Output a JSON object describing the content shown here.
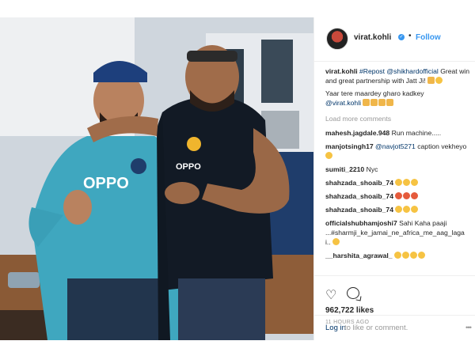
{
  "post": {
    "username": "virat.kohli",
    "follow_label": "Follow",
    "dot": "•",
    "more_icon": "ellipsis-icon"
  },
  "caption": {
    "user": "virat.kohli",
    "repost": "#Repost",
    "mention": "@shikhardofficial",
    "text": "Great win and great partnership with Jatt Ji!",
    "line2": "Yaar tere maardey gharo kadkey",
    "line3_mention": "@virat.kohli"
  },
  "load_more": "Load more comments",
  "comments": [
    {
      "user": "mahesh.jagdale.948",
      "text": "Run machine....."
    },
    {
      "user": "manjotsingh17",
      "mention": "@navjot5271",
      "text": "caption vekheyo"
    },
    {
      "user": "sumiti_2210",
      "text": "Nyc"
    },
    {
      "user": "shahzada_shoaib_74",
      "text": ""
    },
    {
      "user": "shahzada_shoaib_74",
      "text": ""
    },
    {
      "user": "shahzada_shoaib_74",
      "text": ""
    },
    {
      "user": "officialshubhamjoshi7",
      "text": "Sahi Kaha paaji ...#sharmji_ke_jamai_ne_africa_me_aag_laga i.."
    },
    {
      "user": "__harshita_agrawal_",
      "text": ""
    }
  ],
  "likes": "962,722 likes",
  "time_ago": "11 HOURS AGO",
  "login": {
    "link": "Log in",
    "rest": "to like or comment."
  },
  "colors": {
    "link": "#003569",
    "follow": "#3897f0",
    "muted": "#999999"
  }
}
